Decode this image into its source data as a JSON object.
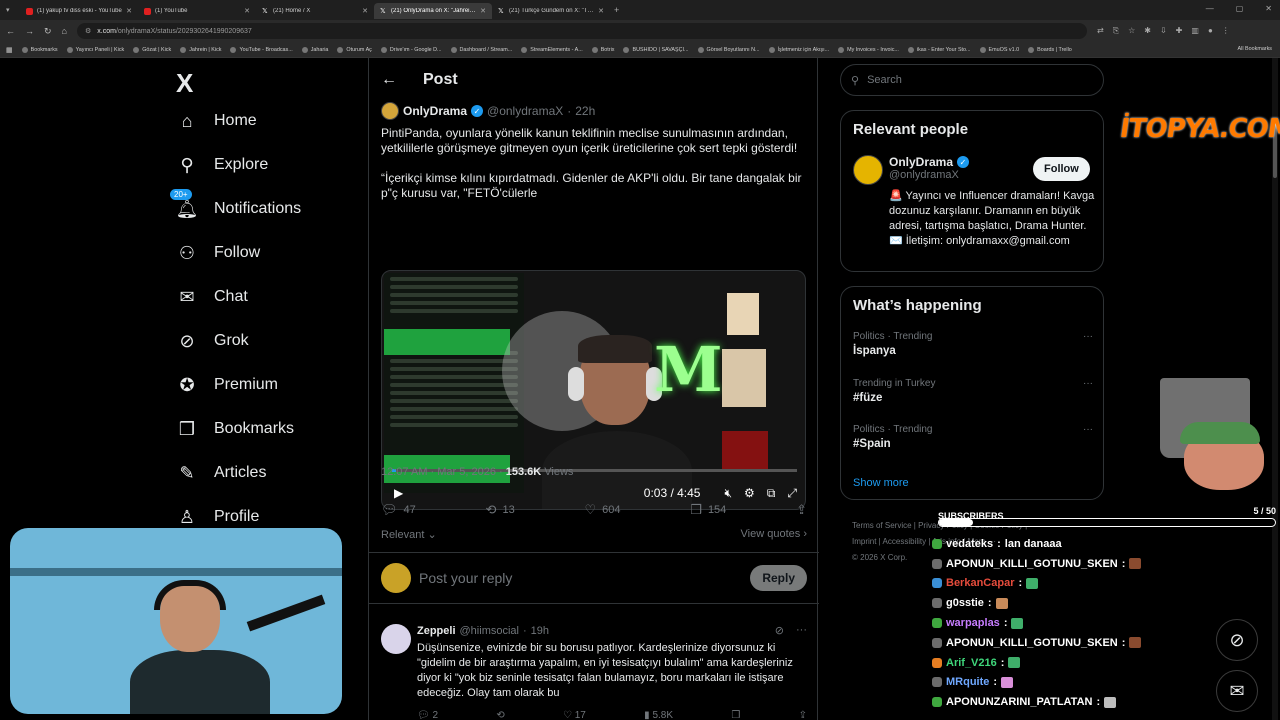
{
  "browser": {
    "tabs": [
      {
        "label": "(1) yakup tv diss eski - YouTube",
        "icon": "youtube-icon",
        "active": false
      },
      {
        "label": "(1) YouTube",
        "icon": "youtube-icon",
        "active": false
      },
      {
        "label": "(21) Home / X",
        "icon": "x-icon",
        "active": false
      },
      {
        "label": "(21) OnlyDrama on X: \"Jahrein...",
        "icon": "x-icon",
        "active": true
      },
      {
        "label": "(21) Türkçe Gündem on X: \"Tür...",
        "icon": "x-icon",
        "active": false
      }
    ],
    "url_host": "x.com",
    "url_path": "/onlydramaX/status/2029302641990209637",
    "bookmarks": [
      "Bookmarks",
      "Yayıncı Paneli | Kick",
      "Gözat | Kick",
      "Jahrein | Kick",
      "YouTube - Broadcas...",
      "Jaharia",
      "Oturum Aç",
      "Drive'ım - Google D...",
      "Dashboard / Stream...",
      "StreamElements - A...",
      "Botrix",
      "BUSHIDO | SAVAŞÇI...",
      "Görsel Boyutlarını N...",
      "İşletmeniz için Akışı...",
      "My Invoices - Invoic...",
      "ikas - Enter Your Sto...",
      "EmuOS v1.0",
      "Boards | Trello"
    ],
    "all_bookmarks": "All Bookmarks"
  },
  "nav": {
    "logo": "X",
    "items": [
      {
        "label": "Home",
        "icon": "home-icon",
        "glyph": "⌂"
      },
      {
        "label": "Explore",
        "icon": "search-icon",
        "glyph": "⚲"
      },
      {
        "label": "Notifications",
        "icon": "bell-icon",
        "glyph": "🔔︎"
      },
      {
        "label": "Follow",
        "icon": "add-person-icon",
        "glyph": "⚇"
      },
      {
        "label": "Chat",
        "icon": "mail-icon",
        "glyph": "✉"
      },
      {
        "label": "Grok",
        "icon": "grok-icon",
        "glyph": "⊘"
      },
      {
        "label": "Premium",
        "icon": "verified-icon",
        "glyph": "✪"
      },
      {
        "label": "Bookmarks",
        "icon": "bookmark-icon",
        "glyph": "❒"
      },
      {
        "label": "Articles",
        "icon": "article-icon",
        "glyph": "✎"
      },
      {
        "label": "Profile",
        "icon": "person-icon",
        "glyph": "♙"
      }
    ],
    "notif_badge": "20+"
  },
  "post": {
    "header_title": "Post",
    "author_name": "OnlyDrama",
    "author_handle": "@onlydramaX",
    "dot": "·",
    "time": "22h",
    "text": "PintiPanda, oyunlara yönelik kanun teklifinin meclise sunulmasının ardından, yetkililerle görüşmeye gitmeyen oyun içerik üreticilerine çok sert tepki gösterdi!\n\n“İçerikçi kimse kılını kıpırdatmadı. Gidenler de AKP'li oldu. Bir tane dangalak bir p\"ç kurusu var, \"FETÖ'cülerle",
    "video_time": "0:03 / 4:45",
    "video_progress": 0.01,
    "timestamp": "12:07 AM · Mar 5, 2026 · ",
    "views_count": "153.6K",
    "views_label": " Views",
    "replies": "47",
    "reposts": "13",
    "likes": "604",
    "bookmarks": "154",
    "sort_label": "Relevant",
    "view_quotes": "View quotes",
    "reply_placeholder": "Post your reply",
    "reply_button": "Reply"
  },
  "reply": {
    "name": "Zeppeli",
    "handle": "@hiimsocial",
    "dot": "·",
    "time": "19h",
    "text": "Düşünsenize, evinizde bir su borusu patlıyor. Kardeşlerinize diyorsunuz ki \"gidelim de bir araştırma yapalım, en iyi tesisatçıyı bulalım\" ama kardeşleriniz diyor ki \"yok biz seninle tesisatçı falan bulamayız, boru markaları ile istişare edeceğiz. Olay tam olarak bu",
    "replies": "2",
    "reposts": "",
    "likes": "17",
    "views": "5.8K"
  },
  "right": {
    "search_placeholder": "Search",
    "relevant_title": "Relevant people",
    "rp_name": "OnlyDrama",
    "rp_handle": "@onlydramaX",
    "follow_label": "Follow",
    "rp_bio": "🚨 Yayıncı ve Influencer dramaları! Kavga dozunuz karşılanır. Dramanın en büyük adresi, tartışma başlatıcı, Drama Hunter. ✉️ İletişim: onlydramaxx@gmail.com",
    "happening_title": "What’s happening",
    "trends": [
      {
        "context": "Politics · Trending",
        "name": "İspanya"
      },
      {
        "context": "Trending in Turkey",
        "name": "#füze"
      },
      {
        "context": "Politics · Trending",
        "name": "#Spain"
      }
    ],
    "show_more": "Show more",
    "footer_line1": "Terms of Service | Privacy Policy | Cookie Policy |",
    "footer_line2": "Imprint | Accessibility | Ads info | More ···",
    "footer_line3": "© 2026 X Corp."
  },
  "overlay": {
    "brand": "İTOPYA.COM",
    "subs_label": "SUBSCRIBERS",
    "subs_count": "5 / 50",
    "subs_progress": 0.1,
    "chat": [
      {
        "user": "vedateks",
        "msg": "lan danaaa",
        "color": "#ffffff",
        "badge": "#3fa83f",
        "emote": ""
      },
      {
        "user": "APONUN_KILLI_GOTUNU_SKEN",
        "msg": "",
        "color": "#ffffff",
        "badge": "#6b6b6b",
        "emote": "#8a4b2f"
      },
      {
        "user": "BerkanCapar",
        "msg": "",
        "color": "#e74c3c",
        "badge": "#3a8fd6",
        "emote": "#3fae6a"
      },
      {
        "user": "g0sstie",
        "msg": "",
        "color": "#ffffff",
        "badge": "#6b6b6b",
        "emote": "#c98b5a"
      },
      {
        "user": "warpaplas",
        "msg": "",
        "color": "#c77dff",
        "badge": "#3fa83f",
        "emote": "#3fae6a"
      },
      {
        "user": "APONUN_KILLI_GOTUNU_SKEN",
        "msg": "",
        "color": "#ffffff",
        "badge": "#6b6b6b",
        "emote": "#8a4b2f"
      },
      {
        "user": "Arif_V216",
        "msg": "",
        "color": "#3fd67b",
        "badge": "#e67e22",
        "emote": "#3fae6a"
      },
      {
        "user": "MRquite",
        "msg": "",
        "color": "#6fa8ff",
        "badge": "#6b6b6b",
        "emote": "#d98fd9"
      },
      {
        "user": "APONUNZARINI_PATLATAN",
        "msg": "",
        "color": "#ffffff",
        "badge": "#3fa83f",
        "emote": "#bdbdbd"
      }
    ]
  },
  "colors": {
    "accent": "#1d9bf0",
    "background": "#000000",
    "text": "#e7e9ea",
    "muted": "#71767b",
    "brand": "#ff7a00"
  }
}
